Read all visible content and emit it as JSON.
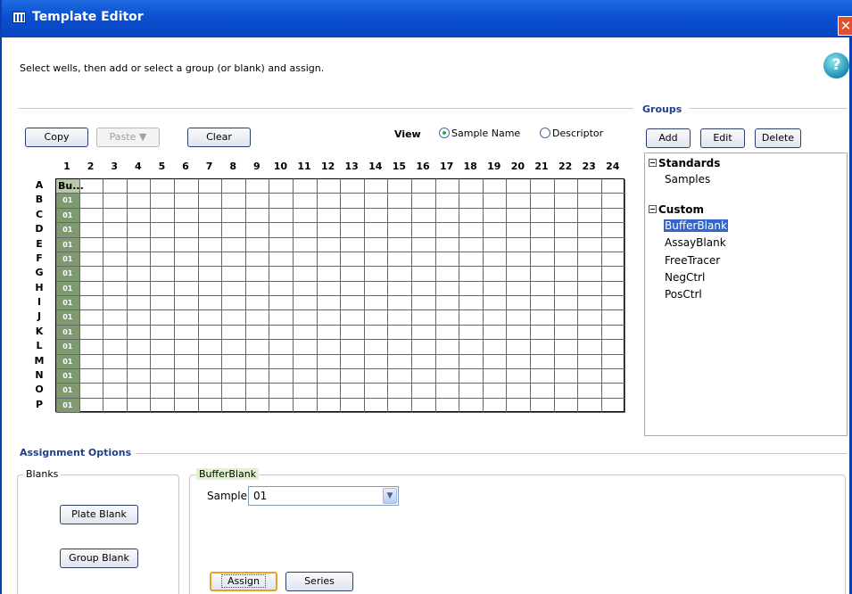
{
  "window": {
    "title": "Template Editor",
    "close_glyph": "✕"
  },
  "instruction": "Select wells, then add or select a group (or blank) and assign.",
  "help_glyph": "?",
  "toolbar": {
    "copy": "Copy",
    "paste": "Paste ▼",
    "clear": "Clear",
    "view_label": "View",
    "view_options": [
      "Sample Name",
      "Descriptor"
    ],
    "view_selected": "Sample Name"
  },
  "plate": {
    "columns": [
      "1",
      "2",
      "3",
      "4",
      "5",
      "6",
      "7",
      "8",
      "9",
      "10",
      "11",
      "12",
      "13",
      "14",
      "15",
      "16",
      "17",
      "18",
      "19",
      "20",
      "21",
      "22",
      "23",
      "24"
    ],
    "rows": [
      "A",
      "B",
      "C",
      "D",
      "E",
      "F",
      "G",
      "H",
      "I",
      "J",
      "K",
      "L",
      "M",
      "N",
      "O",
      "P"
    ],
    "assigned_column": 1,
    "first_cell_text": "Bu...",
    "other_cell_text": "01"
  },
  "groups": {
    "title": "Groups",
    "add": "Add",
    "edit": "Edit",
    "delete": "Delete",
    "tree": [
      {
        "label": "Standards",
        "children": [
          "Samples"
        ]
      },
      {
        "label": "Custom",
        "children": [
          "BufferBlank",
          "AssayBlank",
          "FreeTracer",
          "NegCtrl",
          "PosCtrl"
        ]
      }
    ],
    "selected": "BufferBlank"
  },
  "assignment": {
    "title": "Assignment Options",
    "blanks_legend": "Blanks",
    "plate_blank": "Plate Blank",
    "group_blank": "Group Blank",
    "group_legend": "BufferBlank",
    "sample_label": "Sample",
    "sample_value": "01",
    "assign": "Assign",
    "series": "Series"
  },
  "colors": {
    "title_bar": "#0a4fd0",
    "assigned_well": "#7f9a70",
    "section_title": "#1f3f8a",
    "selection": "#3266cc"
  },
  "icons": {
    "app": "plate-grid-icon",
    "close": "close-icon",
    "help": "help-icon",
    "dropdown": "chevron-down-icon",
    "tree_toggle": "collapse-minus-icon"
  }
}
